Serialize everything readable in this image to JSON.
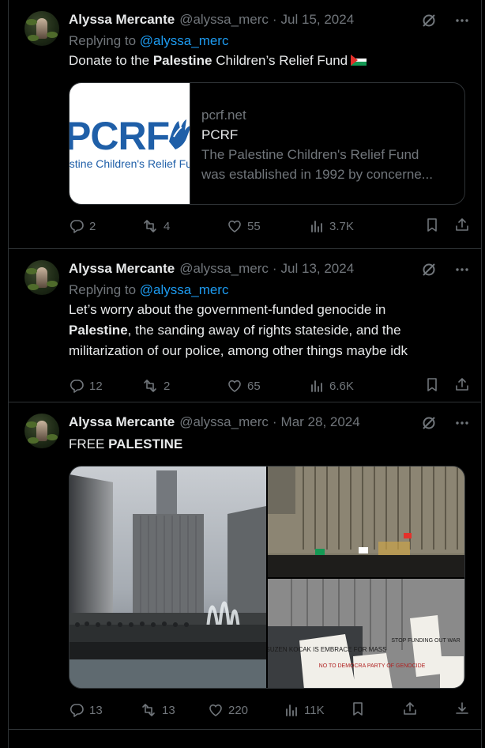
{
  "tweets": [
    {
      "name": "Alyssa Mercante",
      "handle": "@alyssa_merc",
      "sep": "·",
      "date": "Jul 15, 2024",
      "replying_prefix": "Replying to",
      "replying_to": "@alyssa_merc",
      "text_pre": "Donate to the ",
      "text_bold": "Palestine",
      "text_post": " Children’s Relief Fund",
      "flag_icon": "palestine-flag-emoji",
      "card": {
        "logo_text": "PCRF",
        "logo_sub": "estine Children's Relief Fu",
        "domain": "pcrf.net",
        "title": "PCRF",
        "desc_line1": "The Palestine Children's Relief Fund",
        "desc_line2": "was established in 1992 by concerne..."
      },
      "replies": "2",
      "reposts": "4",
      "likes": "55",
      "views": "3.7K"
    },
    {
      "name": "Alyssa Mercante",
      "handle": "@alyssa_merc",
      "sep": "·",
      "date": "Jul 13, 2024",
      "replying_prefix": "Replying to",
      "replying_to": "@alyssa_merc",
      "line1": "Let’s worry about the government-funded genocide in",
      "line2_bold": "Palestine",
      "line2_rest": ", the sanding away of rights stateside, and the",
      "line3": "militarization of our police, among other things maybe idk",
      "replies": "12",
      "reposts": "2",
      "likes": "65",
      "views": "6.6K"
    },
    {
      "name": "Alyssa Mercante",
      "handle": "@alyssa_merc",
      "sep": "·",
      "date": "Mar 28, 2024",
      "text_pre": "FREE ",
      "text_bold": "PALESTINE",
      "photo_signs": [
        "SUZEN KOCAK IS EMBRACE FOR MASS",
        "NO TO DEMOCRA PARTY OF GENOCIDE",
        "STOP FUNDING OUT WAR"
      ],
      "replies": "13",
      "reposts": "13",
      "likes": "220",
      "views": "11K"
    }
  ],
  "colors": {
    "background": "#000000",
    "text": "#e7e9ea",
    "muted": "#71767b",
    "link": "#1d9bf0",
    "border": "#2f3336"
  }
}
